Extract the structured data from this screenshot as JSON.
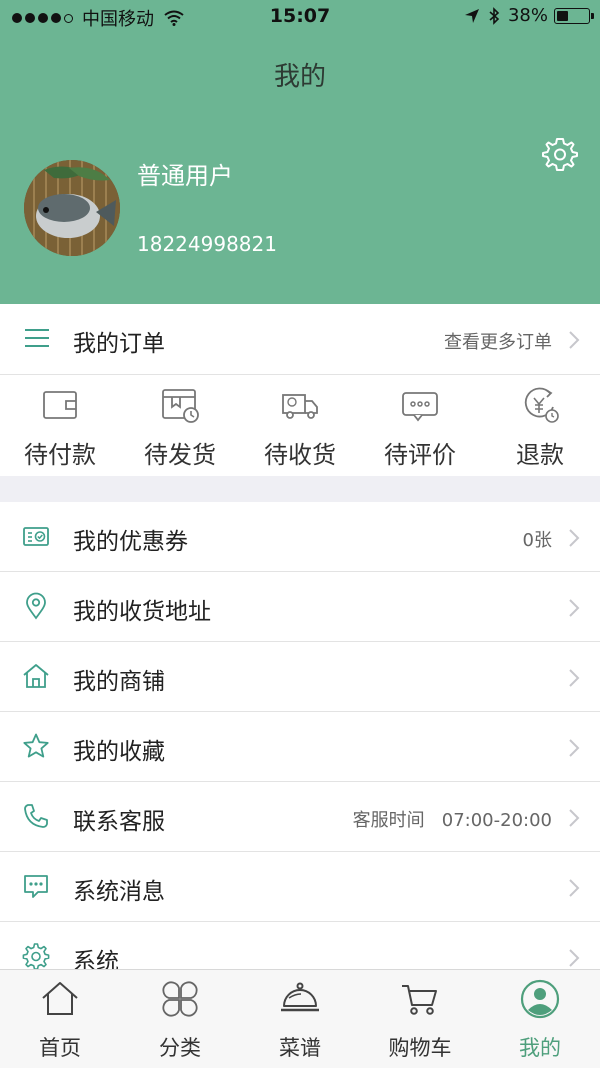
{
  "status_bar": {
    "carrier": "中国移动",
    "time": "15:07",
    "battery": "38%",
    "battery_level": 0.38
  },
  "header": {
    "title": "我的",
    "user_name": "普通用户",
    "user_phone": "18224998821"
  },
  "orders": {
    "title": "我的订单",
    "more_label": "查看更多订单",
    "statuses": [
      {
        "label": "待付款",
        "icon": "wallet-icon"
      },
      {
        "label": "待发货",
        "icon": "box-clock-icon"
      },
      {
        "label": "待收货",
        "icon": "truck-icon"
      },
      {
        "label": "待评价",
        "icon": "comment-icon"
      },
      {
        "label": "退款",
        "icon": "yen-refund-icon"
      }
    ]
  },
  "menu": [
    {
      "label": "我的优惠券",
      "value": "0张",
      "icon": "coupon-icon"
    },
    {
      "label": "我的收货地址",
      "value": "",
      "icon": "location-pin-icon"
    },
    {
      "label": "我的商铺",
      "value": "",
      "icon": "shop-house-icon"
    },
    {
      "label": "我的收藏",
      "value": "",
      "icon": "star-icon"
    },
    {
      "label": "联系客服",
      "value": "客服时间   07:00-20:00",
      "icon": "phone-icon"
    },
    {
      "label": "系统消息",
      "value": "",
      "icon": "message-icon"
    },
    {
      "label": "系统",
      "value": "",
      "icon": "gear-icon"
    }
  ],
  "tabbar": [
    {
      "label": "首页",
      "icon": "home-icon"
    },
    {
      "label": "分类",
      "icon": "category-icon"
    },
    {
      "label": "菜谱",
      "icon": "recipe-cloche-icon"
    },
    {
      "label": "购物车",
      "icon": "cart-icon"
    },
    {
      "label": "我的",
      "icon": "profile-icon",
      "active": true
    }
  ],
  "colors": {
    "header_bg": "#6cb593",
    "accent": "#4e9f7c",
    "icon_teal": "#3f9f8b"
  }
}
